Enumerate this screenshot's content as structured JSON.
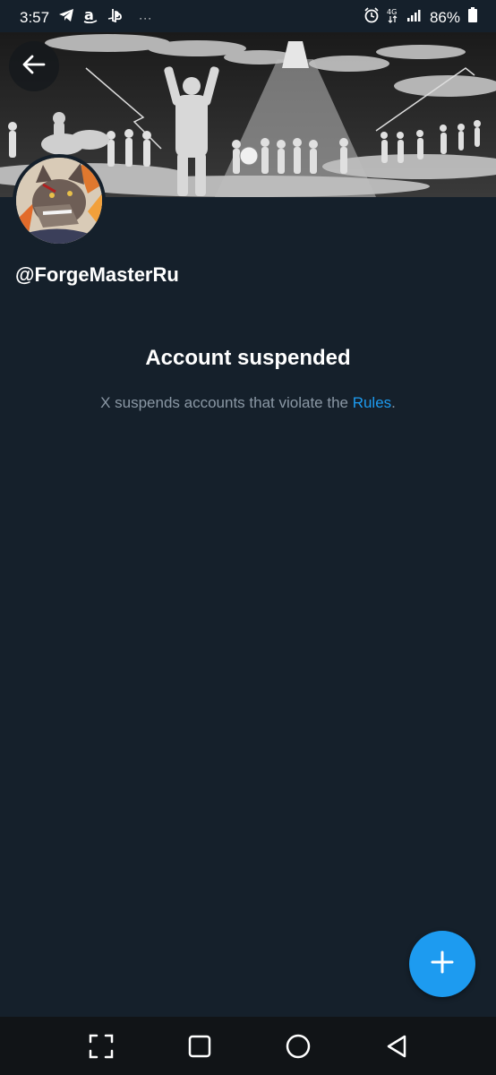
{
  "status_bar": {
    "time": "3:57",
    "battery": "86%",
    "icons": [
      "telegram-icon",
      "amazon-icon",
      "playstation-icon",
      "more-notifications-icon",
      "alarm-icon",
      "volte-icon",
      "signal-icon",
      "battery-icon"
    ]
  },
  "profile": {
    "handle": "@ForgeMasterRu"
  },
  "suspension": {
    "title": "Account suspended",
    "message": "X suspends accounts that violate the ",
    "link": "Rules",
    "end": "."
  },
  "colors": {
    "background": "#15202b",
    "accent": "#1d9bf0",
    "muted_text": "#8b98a5"
  },
  "nav": {
    "buttons": [
      "recents-icon",
      "home-icon",
      "back-icon"
    ]
  }
}
